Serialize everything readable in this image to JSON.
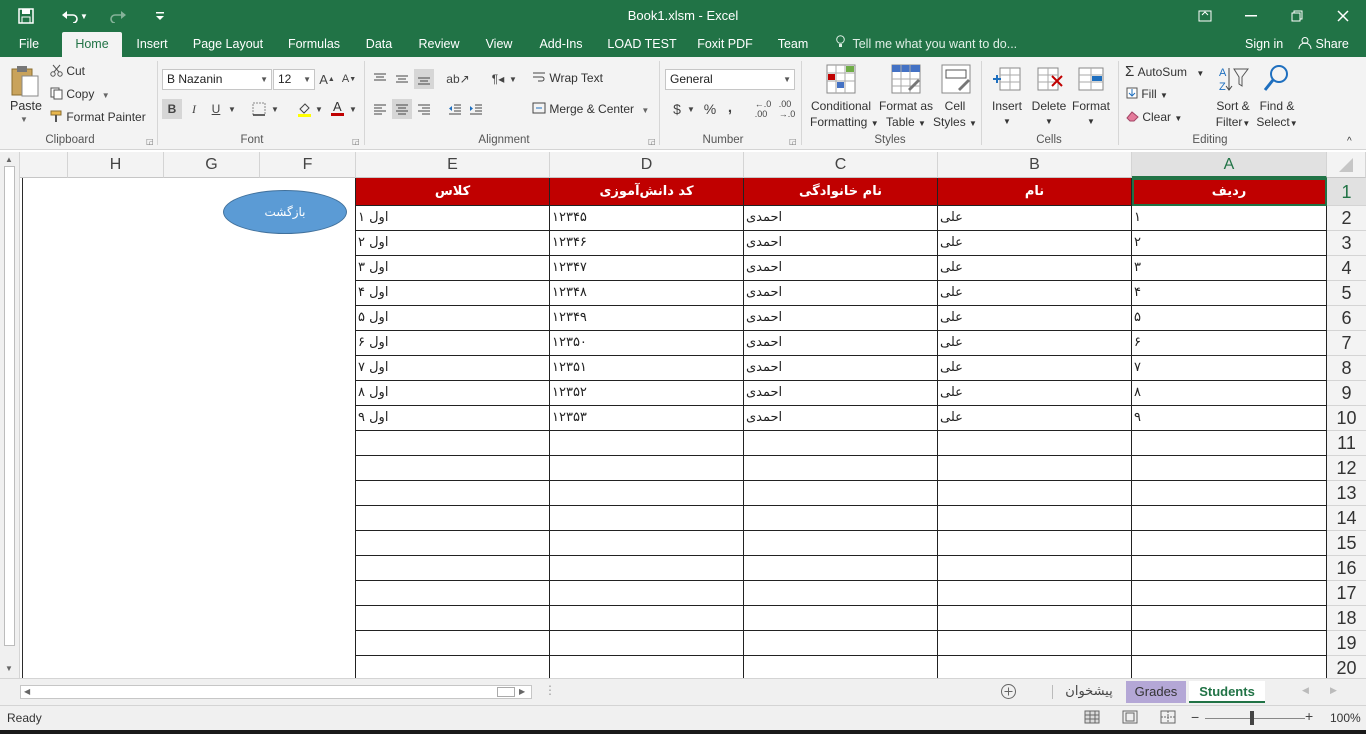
{
  "window": {
    "title": "Book1.xlsm - Excel",
    "controls": {
      "restore_ribbon": "⧉",
      "minimize": "—",
      "restore": "❐",
      "close": "✕"
    }
  },
  "qat": {
    "save": "💾",
    "undo": "↶",
    "redo": "↷",
    "customize": "▾"
  },
  "tabs": [
    "File",
    "Home",
    "Insert",
    "Page Layout",
    "Formulas",
    "Data",
    "Review",
    "View",
    "Add-Ins",
    "LOAD TEST",
    "Foxit PDF",
    "Team"
  ],
  "active_tab": "Home",
  "tell_me": "Tell me what you want to do...",
  "account": {
    "sign_in": "Sign in",
    "share": "Share"
  },
  "ribbon": {
    "clipboard": {
      "label": "Clipboard",
      "paste": "Paste",
      "cut": "Cut",
      "copy": "Copy",
      "format_painter": "Format Painter"
    },
    "font": {
      "label": "Font",
      "name": "B Nazanin",
      "size": "12",
      "bold": "B",
      "italic": "I",
      "underline": "U"
    },
    "alignment": {
      "label": "Alignment",
      "wrap_text": "Wrap Text",
      "merge_center": "Merge & Center"
    },
    "number": {
      "label": "Number",
      "format": "General",
      "currency": "$",
      "percent": "%",
      "comma": ","
    },
    "styles": {
      "label": "Styles",
      "conditional": "Conditional",
      "conditional2": "Formatting",
      "format_as": "Format as",
      "format_as2": "Table",
      "cell": "Cell",
      "cell2": "Styles"
    },
    "cells": {
      "label": "Cells",
      "insert": "Insert",
      "delete": "Delete",
      "format": "Format"
    },
    "editing": {
      "label": "Editing",
      "autosum": "AutoSum",
      "fill": "Fill",
      "clear": "Clear",
      "sort": "Sort &",
      "sort2": "Filter",
      "find": "Find &",
      "find2": "Select"
    }
  },
  "columns": [
    "H",
    "G",
    "F",
    "E",
    "D",
    "C",
    "B",
    "A"
  ],
  "selected_column": "A",
  "rows": [
    "1",
    "2",
    "3",
    "4",
    "5",
    "6",
    "7",
    "8",
    "9",
    "10",
    "11",
    "12",
    "13",
    "14",
    "15",
    "16",
    "17",
    "18",
    "19",
    "20"
  ],
  "selected_row": "1",
  "table": {
    "headers": {
      "A": "ردیف",
      "B": "نام",
      "C": "نام خانوادگی",
      "D": "کد دانش‌آموزی",
      "E": "کلاس"
    },
    "data": [
      {
        "A": "۱",
        "B": "علی",
        "C": "احمدی",
        "D": "۱۲۳۴۵",
        "E": "اول ۱"
      },
      {
        "A": "۲",
        "B": "علی",
        "C": "احمدی",
        "D": "۱۲۳۴۶",
        "E": "اول ۲"
      },
      {
        "A": "۳",
        "B": "علی",
        "C": "احمدی",
        "D": "۱۲۳۴۷",
        "E": "اول ۳"
      },
      {
        "A": "۴",
        "B": "علی",
        "C": "احمدی",
        "D": "۱۲۳۴۸",
        "E": "اول ۴"
      },
      {
        "A": "۵",
        "B": "علی",
        "C": "احمدی",
        "D": "۱۲۳۴۹",
        "E": "اول ۵"
      },
      {
        "A": "۶",
        "B": "علی",
        "C": "احمدی",
        "D": "۱۲۳۵۰",
        "E": "اول ۶"
      },
      {
        "A": "۷",
        "B": "علی",
        "C": "احمدی",
        "D": "۱۲۳۵۱",
        "E": "اول ۷"
      },
      {
        "A": "۸",
        "B": "علی",
        "C": "احمدی",
        "D": "۱۲۳۵۲",
        "E": "اول ۸"
      },
      {
        "A": "۹",
        "B": "علی",
        "C": "احمدی",
        "D": "۱۲۳۵۳",
        "E": "اول ۹"
      }
    ]
  },
  "shape_button": "بازگشت",
  "sheets": [
    {
      "name": "پیشخوان",
      "state": "normal"
    },
    {
      "name": "Grades",
      "state": "highlight"
    },
    {
      "name": "Students",
      "state": "active"
    }
  ],
  "status": {
    "ready": "Ready",
    "zoom": "100%"
  },
  "colors": {
    "excel_green": "#217346",
    "header_red": "#c00000",
    "shape_blue": "#5b9bd5",
    "grades_tab": "#b4a7d6"
  }
}
